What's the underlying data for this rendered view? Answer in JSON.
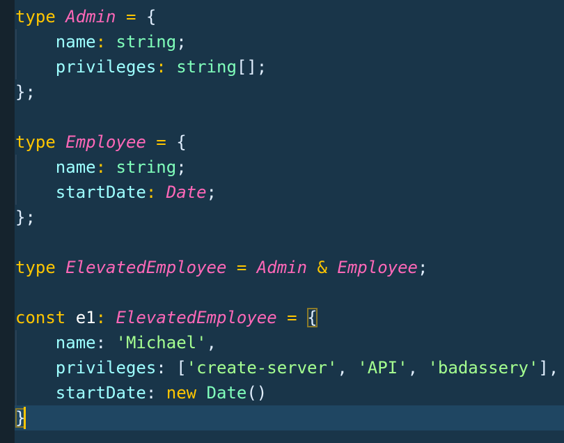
{
  "colors": {
    "background": "#193549",
    "keyword": "#ffc600",
    "type": "#ff68b8",
    "property": "#9effff",
    "string": "#a5ff90",
    "primitive": "#80ffbb",
    "current_line": "#1f4662"
  },
  "editor": {
    "language": "typescript",
    "current_line": 17,
    "lines": [
      [
        {
          "t": "type ",
          "c": "kw"
        },
        {
          "t": "Admin",
          "c": "ty"
        },
        {
          "t": " = ",
          "c": "op"
        },
        {
          "t": "{",
          "c": "punc"
        }
      ],
      [
        {
          "t": "    name",
          "c": "prop"
        },
        {
          "t": ": ",
          "c": "op"
        },
        {
          "t": "string",
          "c": "prim"
        },
        {
          "t": ";",
          "c": "punc"
        }
      ],
      [
        {
          "t": "    privileges",
          "c": "prop"
        },
        {
          "t": ": ",
          "c": "op"
        },
        {
          "t": "string",
          "c": "prim"
        },
        {
          "t": "[];",
          "c": "punc"
        }
      ],
      [
        {
          "t": "};",
          "c": "punc"
        }
      ],
      [],
      [
        {
          "t": "type ",
          "c": "kw"
        },
        {
          "t": "Employee",
          "c": "ty"
        },
        {
          "t": " = ",
          "c": "op"
        },
        {
          "t": "{",
          "c": "punc"
        }
      ],
      [
        {
          "t": "    name",
          "c": "prop"
        },
        {
          "t": ": ",
          "c": "op"
        },
        {
          "t": "string",
          "c": "prim"
        },
        {
          "t": ";",
          "c": "punc"
        }
      ],
      [
        {
          "t": "    startDate",
          "c": "prop"
        },
        {
          "t": ": ",
          "c": "op"
        },
        {
          "t": "Date",
          "c": "ty"
        },
        {
          "t": ";",
          "c": "punc"
        }
      ],
      [
        {
          "t": "};",
          "c": "punc"
        }
      ],
      [],
      [
        {
          "t": "type ",
          "c": "kw"
        },
        {
          "t": "ElevatedEmployee",
          "c": "ty"
        },
        {
          "t": " = ",
          "c": "op"
        },
        {
          "t": "Admin",
          "c": "ty"
        },
        {
          "t": " & ",
          "c": "op"
        },
        {
          "t": "Employee",
          "c": "ty"
        },
        {
          "t": ";",
          "c": "punc"
        }
      ],
      [],
      [
        {
          "t": "const ",
          "c": "kw"
        },
        {
          "t": "e1",
          "c": "var"
        },
        {
          "t": ": ",
          "c": "op"
        },
        {
          "t": "ElevatedEmployee",
          "c": "ty"
        },
        {
          "t": " = ",
          "c": "op"
        },
        {
          "t": "{",
          "c": "punc bracket-match"
        }
      ],
      [
        {
          "t": "    name",
          "c": "prop"
        },
        {
          "t": ": ",
          "c": "punc"
        },
        {
          "t": "'Michael'",
          "c": "str"
        },
        {
          "t": ",",
          "c": "punc"
        }
      ],
      [
        {
          "t": "    privileges",
          "c": "prop"
        },
        {
          "t": ": [",
          "c": "punc"
        },
        {
          "t": "'create-server'",
          "c": "str"
        },
        {
          "t": ", ",
          "c": "punc"
        },
        {
          "t": "'API'",
          "c": "str"
        },
        {
          "t": ", ",
          "c": "punc"
        },
        {
          "t": "'badassery'",
          "c": "str"
        },
        {
          "t": "],",
          "c": "punc"
        }
      ],
      [
        {
          "t": "    startDate",
          "c": "prop"
        },
        {
          "t": ": ",
          "c": "punc"
        },
        {
          "t": "new ",
          "c": "kw"
        },
        {
          "t": "Date",
          "c": "prim"
        },
        {
          "t": "()",
          "c": "punc"
        }
      ],
      [
        {
          "t": "}",
          "c": "punc bracket-match"
        }
      ]
    ]
  }
}
